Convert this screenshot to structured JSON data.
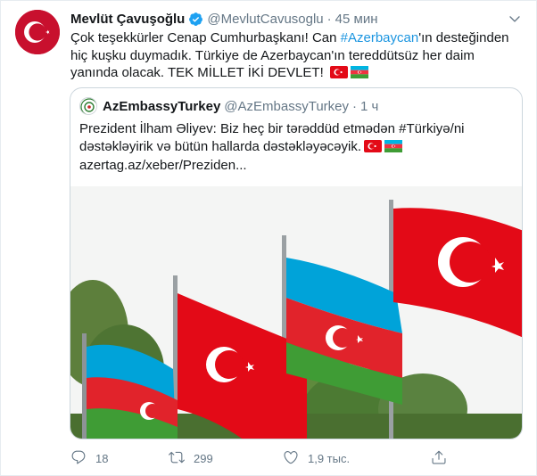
{
  "tweet": {
    "author_name": "Mevlüt Çavuşoğlu",
    "handle": "@MevlutCavusoglu",
    "separator": "·",
    "time": "45 мин",
    "text_part1": "Çok teşekkürler Cenap Cumhurbaşkanı! Can ",
    "hashtag": "#Azerbaycan",
    "text_part2": "'ın desteğinden hiç kuşku duymadık. Türkiye de Azerbaycan'ın tereddütsüz her daim yanında olacak. TEK MİLLET İKİ DEVLET! "
  },
  "quoted": {
    "author_name": "AzEmbassyTurkey",
    "handle": "@AzEmbassyTurkey",
    "separator": "·",
    "time": "1 ч",
    "text": "Prezident İlham Əliyev: Biz heç bir tərəddüd etmədən #Türkiyə/ni dəstəkləyirik və bütün hallarda dəstəkləyəcəyik.",
    "link": "azertag.az/xeber/Preziden..."
  },
  "actions": {
    "reply_count": "18",
    "retweet_count": "299",
    "like_count": "1,9 тыс."
  },
  "colors": {
    "accent": "#1b95e0",
    "turkey_red": "#e30a17",
    "az_blue": "#00b5e2",
    "az_green": "#3f9c35"
  },
  "icons": {
    "verified": "verified-badge-icon",
    "menu": "chevron-down-icon",
    "reply": "reply-icon",
    "retweet": "retweet-icon",
    "like": "heart-icon",
    "share": "share-icon"
  }
}
